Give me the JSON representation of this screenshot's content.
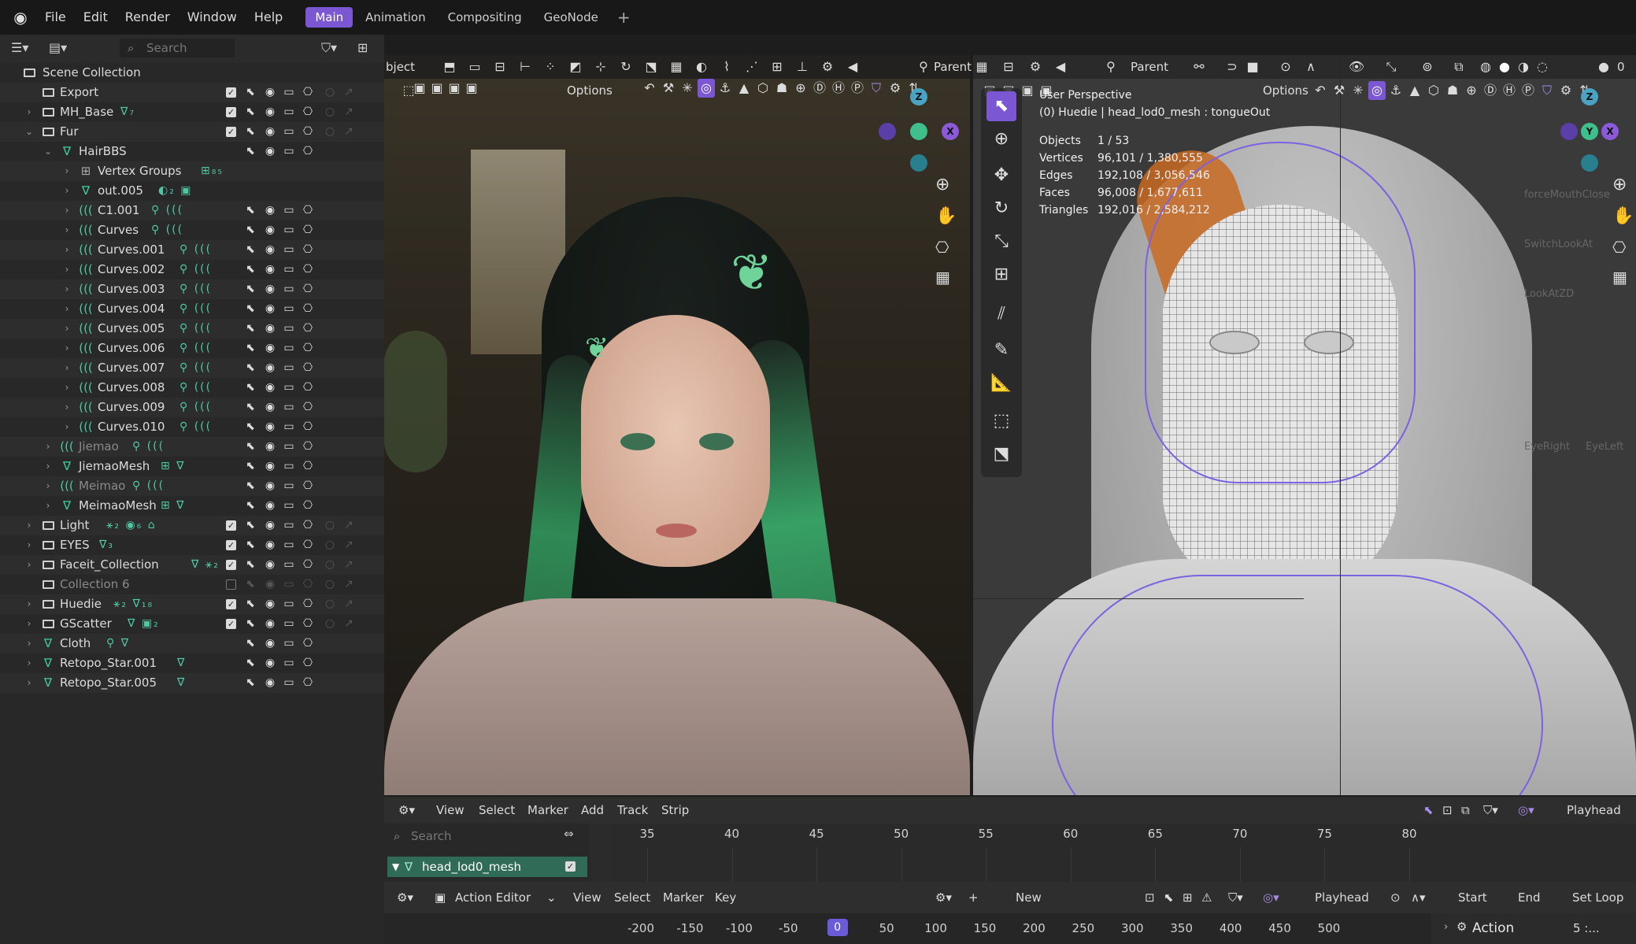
{
  "topbar": {
    "menus": [
      "File",
      "Edit",
      "Render",
      "Window",
      "Help"
    ],
    "workspaces": [
      "Main",
      "Animation",
      "Compositing",
      "GeoNode"
    ],
    "active_workspace": "Main",
    "accent": "#7b57d4"
  },
  "outliner": {
    "search_placeholder": "Search",
    "root": "Scene Collection",
    "rows": [
      {
        "name": "Export",
        "icon": "collection-icon",
        "depth": 1,
        "expand": "",
        "checkbox": true
      },
      {
        "name": "MH_Base",
        "icon": "collection-icon",
        "depth": 1,
        "expand": ">",
        "extra": "∇₇",
        "checkbox": true
      },
      {
        "name": "Fur",
        "icon": "collection-icon",
        "depth": 1,
        "expand": "v",
        "checkbox": true
      },
      {
        "name": "HairBBS",
        "icon": "mesh-icon",
        "depth": 2,
        "expand": "v"
      },
      {
        "name": "Vertex Groups",
        "icon": "vertex-groups-icon",
        "depth": 3,
        "expand": ">",
        "extra": "⊞₈₅",
        "norender": true
      },
      {
        "name": "out.005",
        "icon": "mesh-data-icon",
        "depth": 3,
        "expand": ">",
        "extra": "◐₂ ▣",
        "norender": true
      },
      {
        "name": "C1.001",
        "icon": "curves-icon",
        "depth": 3,
        "expand": ">",
        "extra": "⚲ ((("
      },
      {
        "name": "Curves",
        "icon": "curves-icon",
        "depth": 3,
        "expand": ">",
        "extra": "⚲ ((("
      },
      {
        "name": "Curves.001",
        "icon": "curves-icon",
        "depth": 3,
        "expand": ">",
        "extra": "⚲ ((("
      },
      {
        "name": "Curves.002",
        "icon": "curves-icon",
        "depth": 3,
        "expand": ">",
        "extra": "⚲ ((("
      },
      {
        "name": "Curves.003",
        "icon": "curves-icon",
        "depth": 3,
        "expand": ">",
        "extra": "⚲ ((("
      },
      {
        "name": "Curves.004",
        "icon": "curves-icon",
        "depth": 3,
        "expand": ">",
        "extra": "⚲ ((("
      },
      {
        "name": "Curves.005",
        "icon": "curves-icon",
        "depth": 3,
        "expand": ">",
        "extra": "⚲ ((("
      },
      {
        "name": "Curves.006",
        "icon": "curves-icon",
        "depth": 3,
        "expand": ">",
        "extra": "⚲ ((("
      },
      {
        "name": "Curves.007",
        "icon": "curves-icon",
        "depth": 3,
        "expand": ">",
        "extra": "⚲ ((("
      },
      {
        "name": "Curves.008",
        "icon": "curves-icon",
        "depth": 3,
        "expand": ">",
        "extra": "⚲ ((("
      },
      {
        "name": "Curves.009",
        "icon": "curves-icon",
        "depth": 3,
        "expand": ">",
        "extra": "⚲ ((("
      },
      {
        "name": "Curves.010",
        "icon": "curves-icon",
        "depth": 3,
        "expand": ">",
        "extra": "⚲ ((("
      },
      {
        "name": "Jiemao",
        "icon": "curves-icon",
        "depth": 2,
        "expand": ">",
        "extra": "⚲ (((",
        "dim": true
      },
      {
        "name": "JiemaoMesh",
        "icon": "mesh-icon",
        "depth": 2,
        "expand": ">",
        "extra": "⊞ ∇"
      },
      {
        "name": "Meimao",
        "icon": "curves-icon",
        "depth": 2,
        "expand": ">",
        "extra": "⚲ (((",
        "dim": true
      },
      {
        "name": "MeimaoMesh",
        "icon": "mesh-icon",
        "depth": 2,
        "expand": ">",
        "extra": "⊞ ∇"
      },
      {
        "name": "Light",
        "icon": "collection-icon",
        "depth": 1,
        "expand": ">",
        "extra": "⚹₂ ◉₆ ⌂",
        "checkbox": true
      },
      {
        "name": "EYES",
        "icon": "collection-icon",
        "depth": 1,
        "expand": ">",
        "extra": "∇₃",
        "checkbox": true
      },
      {
        "name": "Faceit_Collection",
        "icon": "collection-icon",
        "depth": 1,
        "expand": ">",
        "extra": "∇ ⚹₂",
        "checkbox": true
      },
      {
        "name": "Collection 6",
        "icon": "collection-icon",
        "depth": 1,
        "expand": "",
        "checkbox_off": true,
        "dim": true
      },
      {
        "name": "Huedie",
        "icon": "collection-icon",
        "depth": 1,
        "expand": ">",
        "extra": "⚹₂ ∇₁₈",
        "checkbox": true
      },
      {
        "name": "GScatter",
        "icon": "collection-icon",
        "depth": 1,
        "expand": ">",
        "extra": "∇ ▣₂",
        "checkbox": true
      },
      {
        "name": "Cloth",
        "icon": "mesh-icon",
        "depth": 1,
        "expand": ">",
        "extra": "⚲ ∇"
      },
      {
        "name": "Retopo_Star.001",
        "icon": "mesh-icon",
        "depth": 1,
        "expand": ">",
        "extra": "∇"
      },
      {
        "name": "Retopo_Star.005",
        "icon": "mesh-icon",
        "depth": 1,
        "expand": ">",
        "extra": "∇"
      }
    ]
  },
  "viewport_left": {
    "header_label": "bject",
    "parent_label": "Parent",
    "options_label": "Options"
  },
  "viewport_right": {
    "parent_label": "Parent",
    "options_label": "Options",
    "view_name": "User Perspective",
    "object_info": "(0) Huedie | head_lod0_mesh : tongueOut",
    "stats": [
      {
        "label": "Objects",
        "value": "1 / 53"
      },
      {
        "label": "Vertices",
        "value": "96,101 / 1,380,555"
      },
      {
        "label": "Edges",
        "value": "192,108 / 3,056,546"
      },
      {
        "label": "Faces",
        "value": "96,008 / 1,677,611"
      },
      {
        "label": "Triangles",
        "value": "192,016 / 2,584,212"
      }
    ],
    "frame_counter": "0",
    "bg_labels": [
      "forceMouthClose",
      "SwitchLookAt",
      "LookAtZD",
      "EyeRight",
      "EyeLeft"
    ]
  },
  "timeline": {
    "menus": [
      "View",
      "Select",
      "Marker",
      "Add",
      "Track",
      "Strip"
    ],
    "search_placeholder": "Search",
    "channel": "head_lod0_mesh",
    "frames": [
      "35",
      "40",
      "45",
      "50",
      "55",
      "60",
      "65",
      "70",
      "75",
      "80"
    ],
    "playhead_label": "Playhead"
  },
  "action_editor": {
    "mode": "Action Editor",
    "menus": [
      "View",
      "Select",
      "Marker",
      "Key"
    ],
    "new_label": "New",
    "playhead_label": "Playhead",
    "start_label": "Start",
    "end_label": "End",
    "set_loop_label": "Set Loop",
    "ruler": [
      "-200",
      "-150",
      "-100",
      "-50",
      "0",
      "50",
      "100",
      "150",
      "200",
      "250",
      "300",
      "350",
      "400",
      "450",
      "500"
    ],
    "current_frame": "0",
    "panel_label": "Action",
    "panel_value": "5 :..."
  }
}
